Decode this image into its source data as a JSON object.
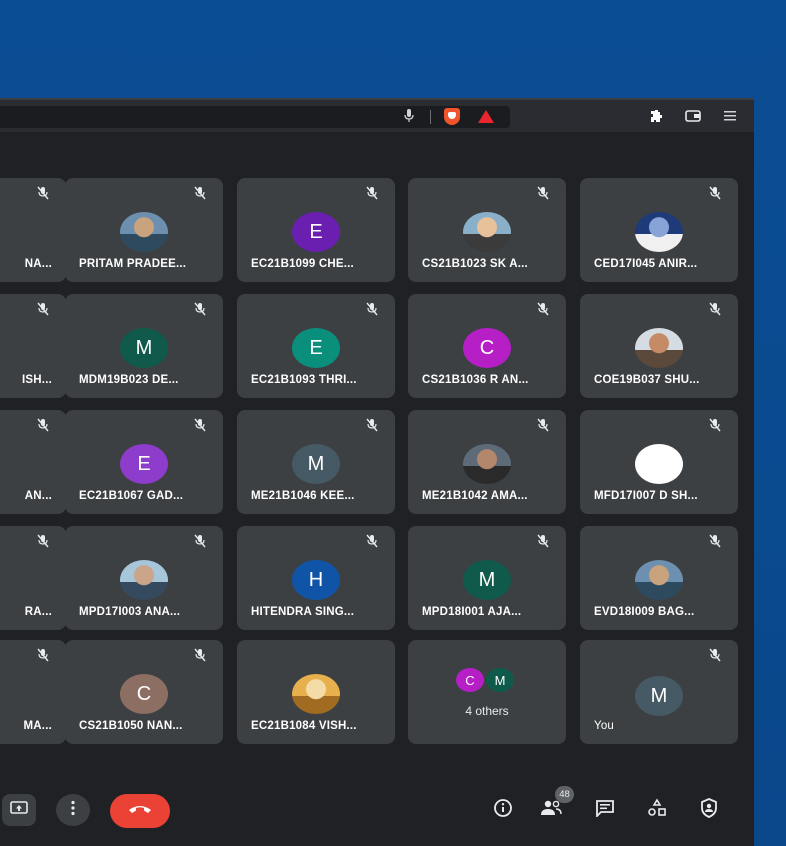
{
  "browser": {
    "toolbar_icons": [
      "microphone-icon",
      "brave-shield-icon",
      "brave-rewards-icon",
      "extensions-icon",
      "wallet-icon",
      "menu-icon"
    ]
  },
  "meeting": {
    "participant_count": "48",
    "tiles": [
      {
        "name": "NA...",
        "muted": true
      },
      {
        "name": "PRITAM PRADEE...",
        "muted": true,
        "avatar_type": "photo"
      },
      {
        "name": "EC21B1099 CHE...",
        "muted": true,
        "initial": "E",
        "color": "#6a1fb0"
      },
      {
        "name": "CS21B1023 SK A...",
        "muted": true,
        "avatar_type": "photo"
      },
      {
        "name": "CED17I045 ANIR...",
        "muted": true,
        "avatar_type": "photo"
      },
      {
        "name": "ISH...",
        "muted": true
      },
      {
        "name": "MDM19B023 DE...",
        "muted": true,
        "initial": "M",
        "color": "#0f5a4a"
      },
      {
        "name": "EC21B1093 THRI...",
        "muted": true,
        "initial": "E",
        "color": "#0a8f7c"
      },
      {
        "name": "CS21B1036 R AN...",
        "muted": true,
        "initial": "C",
        "color": "#b61fc6"
      },
      {
        "name": "COE19B037 SHU...",
        "muted": true,
        "avatar_type": "photo"
      },
      {
        "name": "AN...",
        "muted": true
      },
      {
        "name": "EC21B1067 GAD...",
        "muted": true,
        "initial": "E",
        "color": "#8e3ccb"
      },
      {
        "name": "ME21B1046 KEE...",
        "muted": true,
        "initial": "M",
        "color": "#455a64"
      },
      {
        "name": "ME21B1042 AMA...",
        "muted": true,
        "avatar_type": "photo"
      },
      {
        "name": "MFD17I007 D SH...",
        "muted": true,
        "avatar_type": "photo"
      },
      {
        "name": "RA...",
        "muted": true
      },
      {
        "name": "MPD17I003 ANA...",
        "muted": true,
        "avatar_type": "photo"
      },
      {
        "name": "HITENDRA SING...",
        "muted": true,
        "initial": "H",
        "color": "#1054a8"
      },
      {
        "name": "MPD18I001 AJA...",
        "muted": true,
        "initial": "M",
        "color": "#0f5a4a"
      },
      {
        "name": "EVD18I009 BAG...",
        "muted": true,
        "avatar_type": "photo"
      },
      {
        "name": "MA...",
        "muted": true
      },
      {
        "name": "CS21B1050 NAN...",
        "muted": true,
        "initial": "C",
        "color": "#8d6e63"
      },
      {
        "name": "EC21B1084 VISH...",
        "muted": false,
        "avatar_type": "photo"
      }
    ],
    "others_tile": {
      "label": "4 others",
      "initials": [
        {
          "initial": "C",
          "color": "#b61fc6"
        },
        {
          "initial": "M",
          "color": "#0f5a4a"
        }
      ]
    },
    "self_tile": {
      "name": "You",
      "initial": "M",
      "color": "#455a64",
      "muted": true
    }
  },
  "controls": {
    "present_icon": "present-screen-icon",
    "more_icon": "more-options-icon",
    "hangup_icon": "phone-hangup-icon",
    "right_icons": [
      "info-icon",
      "people-icon",
      "chat-icon",
      "activities-icon",
      "host-controls-icon"
    ]
  }
}
